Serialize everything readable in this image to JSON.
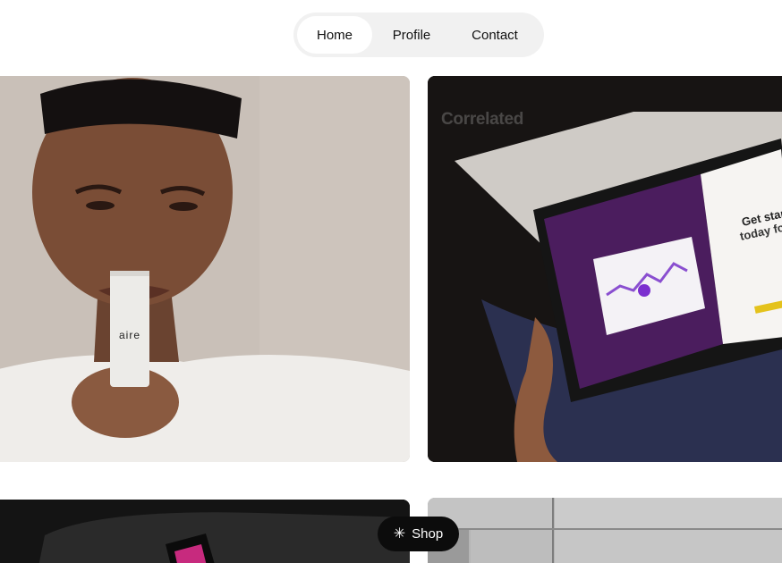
{
  "nav": {
    "items": [
      {
        "label": "Home",
        "active": true
      },
      {
        "label": "Profile",
        "active": false
      },
      {
        "label": "Contact",
        "active": false
      }
    ]
  },
  "projects": [
    {
      "title": "",
      "image": "man-holding-aire-bottle",
      "product_label": "aire"
    },
    {
      "title": "Correlated",
      "image": "hands-holding-tablet-dashboard",
      "tablet_heading_line1": "Get starte",
      "tablet_heading_line2": "today for"
    },
    {
      "title": "",
      "image": "dark-leather-with-phone"
    },
    {
      "title": "",
      "image": "stainless-steel-panels"
    }
  ],
  "shop": {
    "label": "Shop",
    "icon": "asterisk-icon"
  },
  "colors": {
    "accent": "#0c0c0c",
    "nav_bg": "#f1f1f1",
    "tablet_purple": "#4b1d5e"
  }
}
